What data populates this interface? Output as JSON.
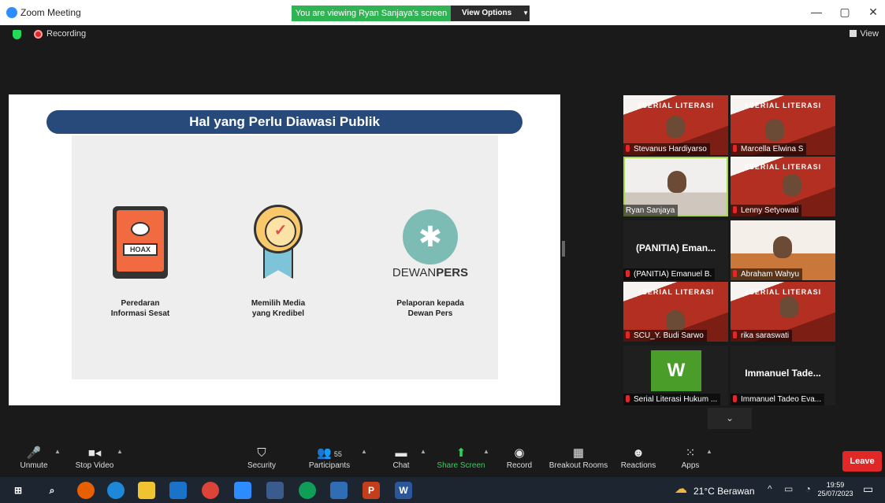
{
  "window": {
    "title": "Zoom Meeting",
    "sharing_banner": "You are viewing Ryan Sanjaya's screen",
    "view_options_label": "View Options",
    "minimize": "—",
    "restore": "▢",
    "close": "✕"
  },
  "status": {
    "recording_label": "Recording",
    "view_label": "View"
  },
  "slide": {
    "title": "Hal yang Perlu Diawasi Publik",
    "hoax_label": "HOAX",
    "logo_text_normal": "DEWAN",
    "logo_text_bold": "PERS",
    "items": [
      {
        "caption_line1": "Peredaran",
        "caption_line2": "Informasi Sesat"
      },
      {
        "caption_line1": "Memilih Media",
        "caption_line2": "yang Kredibel"
      },
      {
        "caption_line1": "Pelaporan kepada",
        "caption_line2": "Dewan Pers"
      }
    ]
  },
  "participants": [
    {
      "name": "Stevanus Hardiyarso",
      "muted": true
    },
    {
      "name": "Marcella Elwina S",
      "muted": true
    },
    {
      "name": "Ryan Sanjaya",
      "muted": false,
      "active_speaker": true
    },
    {
      "name": "Lenny Setyowati",
      "muted": true
    },
    {
      "name": "(PANITIA) Emanuel B.",
      "muted": true,
      "display_center": "(PANITIA) Eman..."
    },
    {
      "name": "Abraham Wahyu",
      "muted": true
    },
    {
      "name": "SCU_Y. Budi Sarwo",
      "muted": true
    },
    {
      "name": "rika saraswati",
      "muted": true
    },
    {
      "name": "Serial Literasi Hukum ...",
      "muted": true,
      "avatar_letter": "W"
    },
    {
      "name": "Immanuel Tadeo Eva...",
      "muted": true,
      "display_center": "Immanuel Tade..."
    }
  ],
  "poster_text": "#SERIAL LITERASI",
  "gallery_next_icon": "chevron-down",
  "toolbar": {
    "unmute": "Unmute",
    "stop_video": "Stop Video",
    "security": "Security",
    "participants": "Participants",
    "participants_count": "55",
    "chat": "Chat",
    "share_screen": "Share Screen",
    "record": "Record",
    "breakout_rooms": "Breakout Rooms",
    "reactions": "Reactions",
    "apps": "Apps",
    "leave": "Leave"
  },
  "taskbar": {
    "weather": "21°C  Berawan",
    "time": "19:59",
    "date": "25/07/2023"
  },
  "colors": {
    "share_banner_green": "#2fb454",
    "leave_red": "#e02828",
    "active_speaker_outline": "#a3d84a",
    "slide_banner_blue": "#284a7a"
  }
}
